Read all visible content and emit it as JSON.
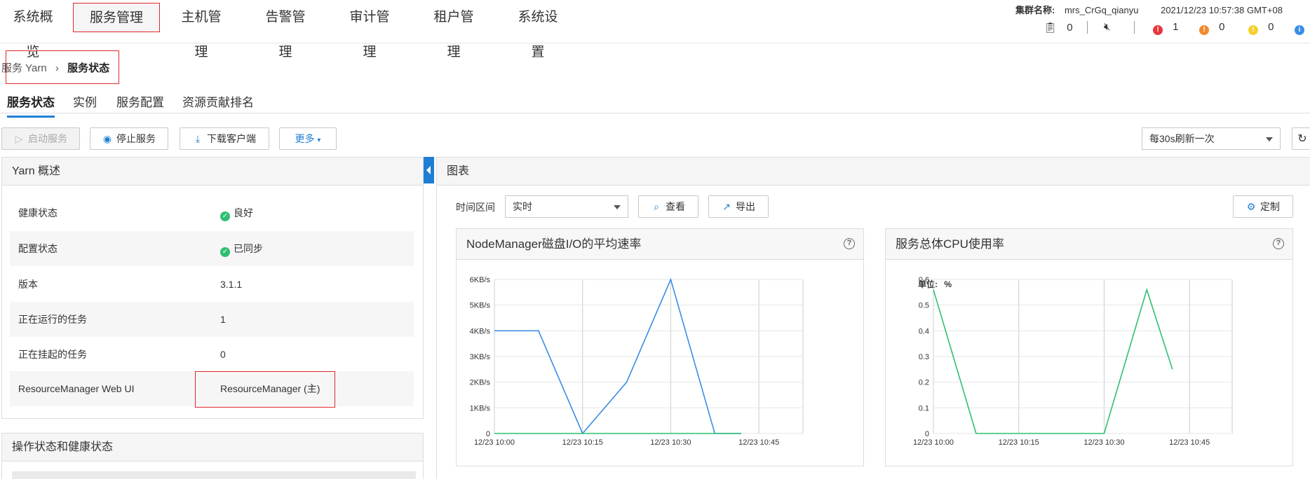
{
  "nav": {
    "items": [
      "系统概览",
      "服务管理",
      "主机管理",
      "告警管理",
      "审计管理",
      "租户管理",
      "系统设置"
    ]
  },
  "header": {
    "cluster_label": "集群名称:",
    "cluster_name": "mrs_CrGq_qianyu",
    "datetime": "2021/12/23 10:57:38 GMT+08",
    "task_count": "0",
    "critical_count": "1",
    "major_count": "0",
    "minor_count": "0"
  },
  "breadcrumb": {
    "parent": "服务 Yarn",
    "sep": "›",
    "current": "服务状态"
  },
  "tabs": [
    "服务状态",
    "实例",
    "服务配置",
    "资源贡献排名"
  ],
  "toolbar": {
    "start": "启动服务",
    "stop": "停止服务",
    "download": "下载客户端",
    "more": "更多",
    "refresh_select": "每30s刷新一次"
  },
  "overview": {
    "title": "Yarn 概述",
    "rows": [
      {
        "key": "健康状态",
        "value": "良好"
      },
      {
        "key": "配置状态",
        "value": "已同步"
      },
      {
        "key": "版本",
        "value": "3.1.1"
      },
      {
        "key": "正在运行的任务",
        "value": "1"
      },
      {
        "key": "正在挂起的任务",
        "value": "0"
      },
      {
        "key": "ResourceManager Web UI",
        "value": "ResourceManager (主)"
      }
    ]
  },
  "ops_panel": {
    "title": "操作状态和健康状态"
  },
  "charts_panel": {
    "title": "图表",
    "time_label": "时间区间",
    "time_value": "实时",
    "view": "查看",
    "export": "导出",
    "customize": "定制"
  },
  "chart_data": [
    {
      "type": "line",
      "title": "NodeManager磁盘I/O的平均速率",
      "x_ticks": [
        "12/23 10:00",
        "12/23 10:15",
        "12/23 10:30",
        "12/23 10:45"
      ],
      "y_ticks": [
        "0",
        "1KB/s",
        "2KB/s",
        "3KB/s",
        "4KB/s",
        "5KB/s",
        "6KB/s"
      ],
      "ylim": [
        0,
        6
      ],
      "series": [
        {
          "color": "#3a8ee6",
          "x": [
            0,
            5,
            10,
            15,
            20,
            25,
            28
          ],
          "y": [
            4,
            4,
            0,
            2,
            6,
            0,
            0
          ]
        },
        {
          "color": "#2fbf71",
          "x": [
            0,
            28
          ],
          "y": [
            0,
            0
          ]
        }
      ]
    },
    {
      "type": "line",
      "title": "服务总体CPU使用率",
      "unit_label": "单位:",
      "unit": "%",
      "x_ticks": [
        "12/23 10:00",
        "12/23 10:15",
        "12/23 10:30",
        "12/23 10:45"
      ],
      "y_ticks": [
        "0",
        "0.1",
        "0.2",
        "0.3",
        "0.4",
        "0.5",
        "0.6"
      ],
      "ylim": [
        0,
        0.6
      ],
      "series": [
        {
          "color": "#2fbf71",
          "x": [
            0,
            5,
            20,
            25,
            28
          ],
          "y": [
            0.56,
            0,
            0,
            0.56,
            0.25
          ]
        }
      ]
    }
  ]
}
